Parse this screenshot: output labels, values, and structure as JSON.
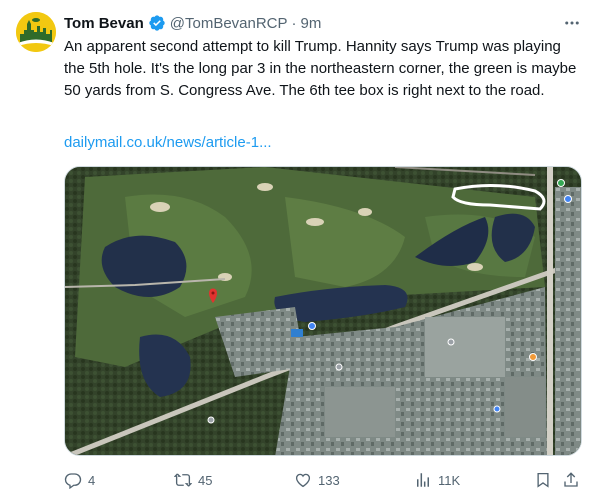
{
  "author": {
    "name": "Tom Bevan",
    "handle": "@TomBevanRCP",
    "separator": "·",
    "time": "9m"
  },
  "tweet": {
    "text": "An apparent second attempt to kill Trump. Hannity says Trump was playing the 5th hole. It's the long par 3 in the northeastern corner, the green is maybe 50 yards from S. Congress Ave. The 6th tee box is right next to the road.",
    "link": "dailymail.co.uk/news/article-1..."
  },
  "metrics": {
    "replies": "4",
    "retweets": "45",
    "likes": "133",
    "views": "11K"
  },
  "colors": {
    "accent": "#1d9bf0",
    "secondary_text": "#536471",
    "avatar_bg": "#f2c811",
    "verified": "#1d9bf0"
  },
  "icons": [
    "verified-badge-icon",
    "more-icon",
    "reply-icon",
    "retweet-icon",
    "like-icon",
    "views-icon",
    "bookmark-icon",
    "share-icon"
  ]
}
